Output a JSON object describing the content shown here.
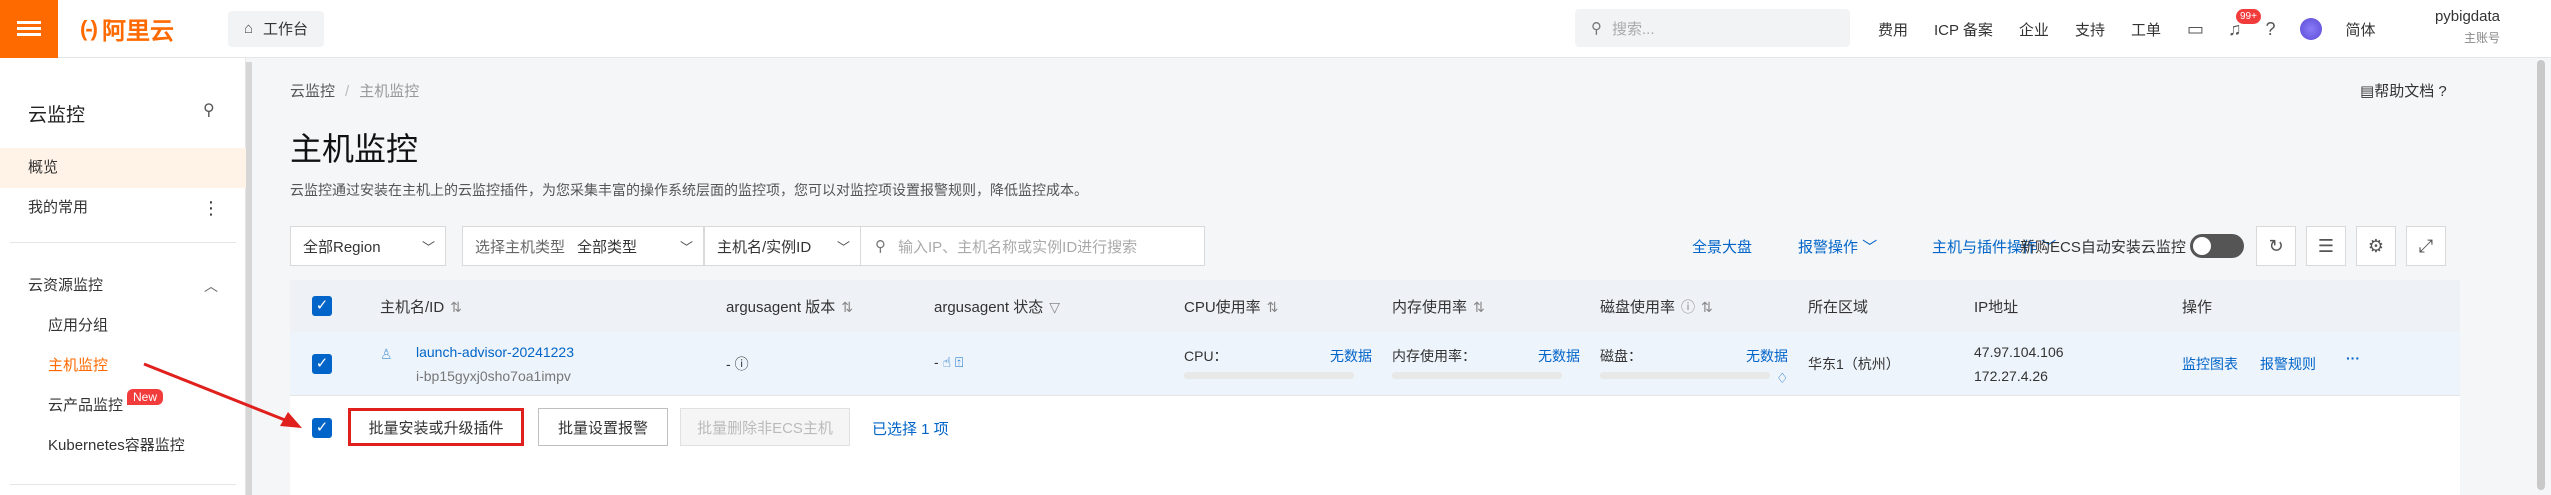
{
  "topbar": {
    "logo_mark": "(-)",
    "logo_text": "阿里云",
    "workspace": "工作台",
    "search_placeholder": "搜索...",
    "nav": [
      "费用",
      "ICP 备案",
      "企业",
      "支持",
      "工单"
    ],
    "notification_badge": "99+",
    "lang": "简体",
    "user_name": "pybigdata",
    "user_role": "主账号"
  },
  "sidebar": {
    "title": "云监控",
    "items": [
      {
        "label": "概览"
      },
      {
        "label": "我的常用"
      },
      {
        "label": "云资源监控"
      },
      {
        "label": "应用分组"
      },
      {
        "label": "主机监控"
      },
      {
        "label": "云产品监控"
      },
      {
        "label": "Kubernetes容器监控"
      }
    ],
    "new_badge": "New"
  },
  "breadcrumb": [
    "云监控",
    "主机监控"
  ],
  "help": "帮助文档",
  "page": {
    "title": "主机监控",
    "description": "云监控通过安装在主机上的云监控插件，为您采集丰富的操作系统层面的监控项，您可以对监控项设置报警规则，降低监控成本。"
  },
  "toolbar": {
    "region": "全部Region",
    "host_type_label": "选择主机类型",
    "host_type_value": "全部类型",
    "search_field": "主机名/实例ID",
    "search_placeholder": "输入IP、主机名称或实例ID进行搜索",
    "dashboard": "全景大盘",
    "alarm_ops": "报警操作",
    "host_plugin_ops": "主机与插件操作",
    "auto_install_label": "新购ECS自动安装云监控"
  },
  "table": {
    "headers": [
      "主机名/ID",
      "argusagent 版本",
      "argusagent 状态",
      "CPU使用率",
      "内存使用率",
      "磁盘使用率",
      "所在区域",
      "IP地址",
      "操作"
    ],
    "rows": [
      {
        "hostname": "launch-advisor-20241223",
        "instance_id": "i-bp15gyxj0sho7oa1impv",
        "version": "-",
        "status": "-",
        "cpu_label": "CPU：",
        "cpu_value": "无数据",
        "mem_label": "内存使用率：",
        "mem_value": "无数据",
        "disk_label": "磁盘：",
        "disk_value": "无数据",
        "region": "华东1（杭州）",
        "ip_public": "47.97.104.106",
        "ip_private": "172.27.4.26",
        "op_chart": "监控图表",
        "op_alarm": "报警规则",
        "op_more": "···"
      }
    ]
  },
  "footer": {
    "btn_install": "批量安装或升级插件",
    "btn_alarm": "批量设置报警",
    "btn_delete": "批量删除非ECS主机",
    "selected": "已选择 1 项"
  },
  "colors": {
    "brand": "#ff6a00",
    "link": "#0064c8",
    "highlight": "#e0201c"
  }
}
